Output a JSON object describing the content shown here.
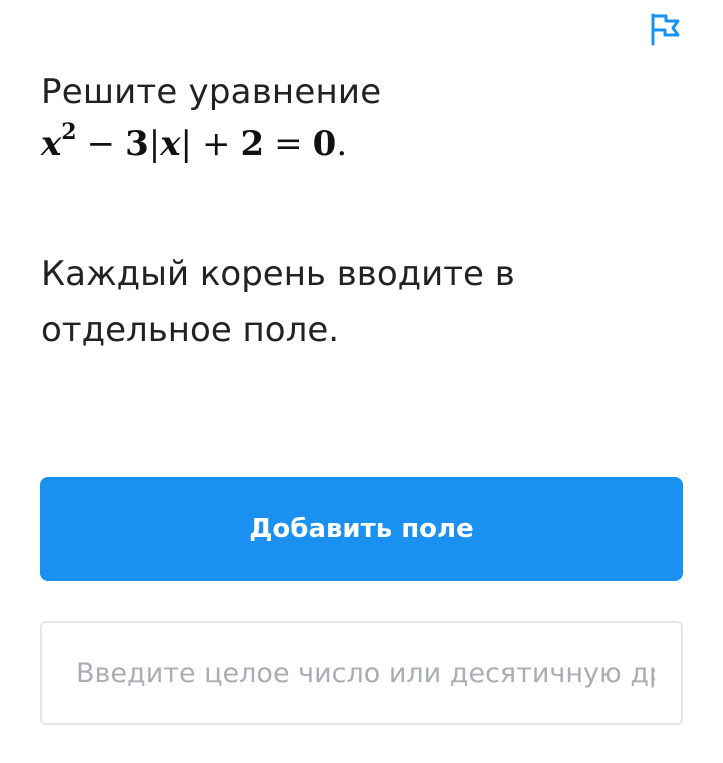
{
  "header": {
    "flag_icon": "report-flag-icon",
    "accent_color": "#1a91f0"
  },
  "question": {
    "title": "Решите уравнение",
    "equation": {
      "x": "x",
      "exp": "2",
      "minus": "−",
      "three": "3",
      "abs_open": "|",
      "abs_var": "x",
      "abs_close": "|",
      "plus": "+",
      "two": "2",
      "equals": "=",
      "zero": "0",
      "period": "."
    }
  },
  "hint": {
    "text": "Каждый корень вводите в отдельное поле."
  },
  "actions": {
    "add_field_label": "Добавить поле"
  },
  "answer": {
    "value": "",
    "placeholder": "Введите целое число или десятичную др"
  }
}
